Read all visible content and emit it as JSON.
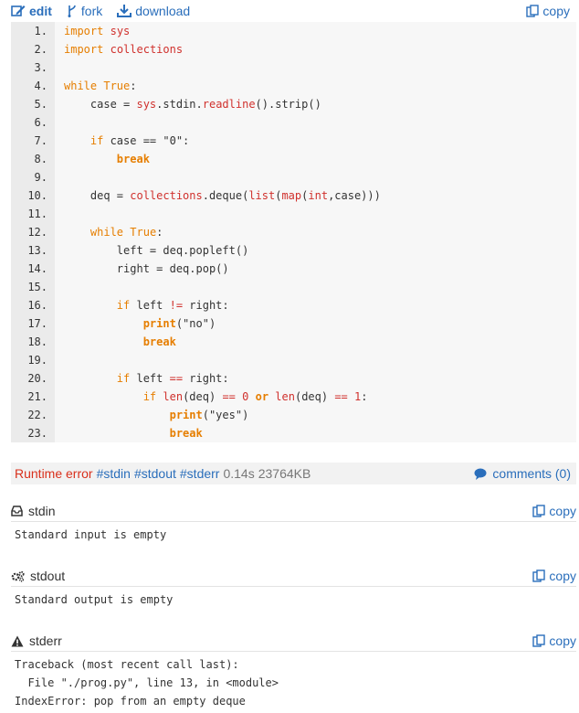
{
  "toolbar": {
    "edit": "edit",
    "fork": "fork",
    "download": "download",
    "copy": "copy"
  },
  "code_lines": [
    {
      "n": "1.",
      "h": "<span class=\"kw2\">import</span> <span class=\"red\">sys</span>"
    },
    {
      "n": "2.",
      "h": "<span class=\"kw2\">import</span> <span class=\"red\">collections</span>"
    },
    {
      "n": "3.",
      "h": ""
    },
    {
      "n": "4.",
      "h": "<span class=\"kw2\">while</span> <span class=\"kw2\">True</span>:"
    },
    {
      "n": "5.",
      "h": "    case = <span class=\"red\">sys</span>.stdin.<span class=\"red\">readline</span>().strip()"
    },
    {
      "n": "6.",
      "h": ""
    },
    {
      "n": "7.",
      "h": "    <span class=\"kw2\">if</span> case == \"0\":"
    },
    {
      "n": "8.",
      "h": "        <span class=\"kw\">break</span>"
    },
    {
      "n": "9.",
      "h": ""
    },
    {
      "n": "10.",
      "h": "    deq = <span class=\"red\">collections</span>.deque(<span class=\"red\">list</span>(<span class=\"red\">map</span>(<span class=\"red\">int</span>,case)))"
    },
    {
      "n": "11.",
      "h": ""
    },
    {
      "n": "12.",
      "h": "    <span class=\"kw2\">while</span> <span class=\"kw2\">True</span>:"
    },
    {
      "n": "13.",
      "h": "        left = deq.popleft()"
    },
    {
      "n": "14.",
      "h": "        right = deq.pop()"
    },
    {
      "n": "15.",
      "h": ""
    },
    {
      "n": "16.",
      "h": "        <span class=\"kw2\">if</span> left <span class=\"red\">!=</span> right:"
    },
    {
      "n": "17.",
      "h": "            <span class=\"kw\">print</span>(\"no\")"
    },
    {
      "n": "18.",
      "h": "            <span class=\"kw\">break</span>"
    },
    {
      "n": "19.",
      "h": ""
    },
    {
      "n": "20.",
      "h": "        <span class=\"kw2\">if</span> left <span class=\"red\">==</span> right:"
    },
    {
      "n": "21.",
      "h": "            <span class=\"kw2\">if</span> <span class=\"red\">len</span>(deq) <span class=\"red\">==</span> <span class=\"red\">0</span> <span class=\"kw\">or</span> <span class=\"red\">len</span>(deq) <span class=\"red\">==</span> <span class=\"red\">1</span>:"
    },
    {
      "n": "22.",
      "h": "                <span class=\"kw\">print</span>(\"yes\")"
    },
    {
      "n": "23.",
      "h": "                <span class=\"kw\">break</span>"
    }
  ],
  "status": {
    "result": "Runtime error",
    "tags": [
      "#stdin",
      "#stdout",
      "#stderr"
    ],
    "time": "0.14s",
    "memory": "23764KB",
    "comments": "comments (0)"
  },
  "stdin": {
    "title": "stdin",
    "copy": "copy",
    "body": "Standard input is empty"
  },
  "stdout": {
    "title": "stdout",
    "copy": "copy",
    "body": "Standard output is empty"
  },
  "stderr": {
    "title": "stderr",
    "copy": "copy",
    "body": "Traceback (most recent call last):\n  File \"./prog.py\", line 13, in <module>\nIndexError: pop from an empty deque"
  },
  "colors": {
    "link": "#2a6ebb",
    "error": "#d9301c",
    "keyword": "#e67e00",
    "builtin": "#d0312d"
  }
}
